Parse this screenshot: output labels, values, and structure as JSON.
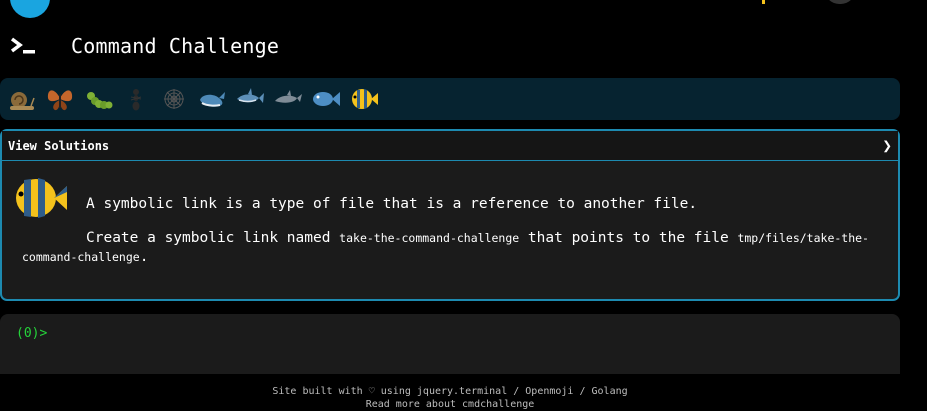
{
  "app": {
    "title": "Command Challenge"
  },
  "levels": [
    {
      "icon": "snail-icon"
    },
    {
      "icon": "butterfly-icon"
    },
    {
      "icon": "caterpillar-icon"
    },
    {
      "icon": "ant-icon"
    },
    {
      "icon": "spider-web-icon"
    },
    {
      "icon": "whale-icon"
    },
    {
      "icon": "shark-icon"
    },
    {
      "icon": "dolphin-icon"
    },
    {
      "icon": "fish-icon"
    },
    {
      "icon": "tropical-fish-icon",
      "active": true
    }
  ],
  "challenge": {
    "view_solutions": "View Solutions",
    "toggle": "❯",
    "description": "A symbolic link is a type of file that is a reference to another file.",
    "instruction_prefix": "Create a symbolic link named ",
    "link_name": "take-the-command-challenge",
    "instruction_middle": " that points to the file ",
    "target_path": "tmp/files/take-the-command-challenge",
    "instruction_suffix": "."
  },
  "terminal": {
    "prompt": "(0)>"
  },
  "footer": {
    "built_prefix": "Site built with",
    "heart": "♡",
    "built_using": "using",
    "link_jquery": "jquery.terminal",
    "link_openmoji": "Openmoji",
    "link_golang": "Golang",
    "read_more": "Read more about cmdchallenge"
  },
  "colors": {
    "background": "#000000",
    "level_bar": "#062330",
    "panel_border": "#1d8ab0",
    "panel_bg": "#1b1b1b",
    "prompt_green": "#25d33a",
    "accent_blue": "#1aa5e0"
  }
}
